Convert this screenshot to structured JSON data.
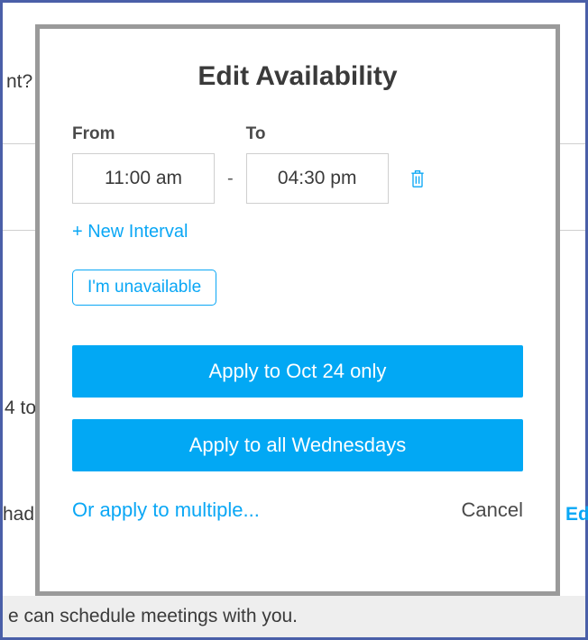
{
  "background": {
    "text_top": "nt?",
    "text_mid1": "4 to",
    "text_mid2": "had",
    "text_right": "Ed",
    "footer_text": "e can schedule meetings with you."
  },
  "modal": {
    "title": "Edit Availability",
    "from_label": "From",
    "to_label": "To",
    "interval": {
      "from": "11:00 am",
      "to": "04:30 pm"
    },
    "new_interval_label": "+ New Interval",
    "unavailable_label": "I'm unavailable",
    "apply_single_label": "Apply to Oct 24 only",
    "apply_recurring_label": "Apply to all Wednesdays",
    "apply_multiple_label": "Or apply to multiple...",
    "cancel_label": "Cancel"
  }
}
